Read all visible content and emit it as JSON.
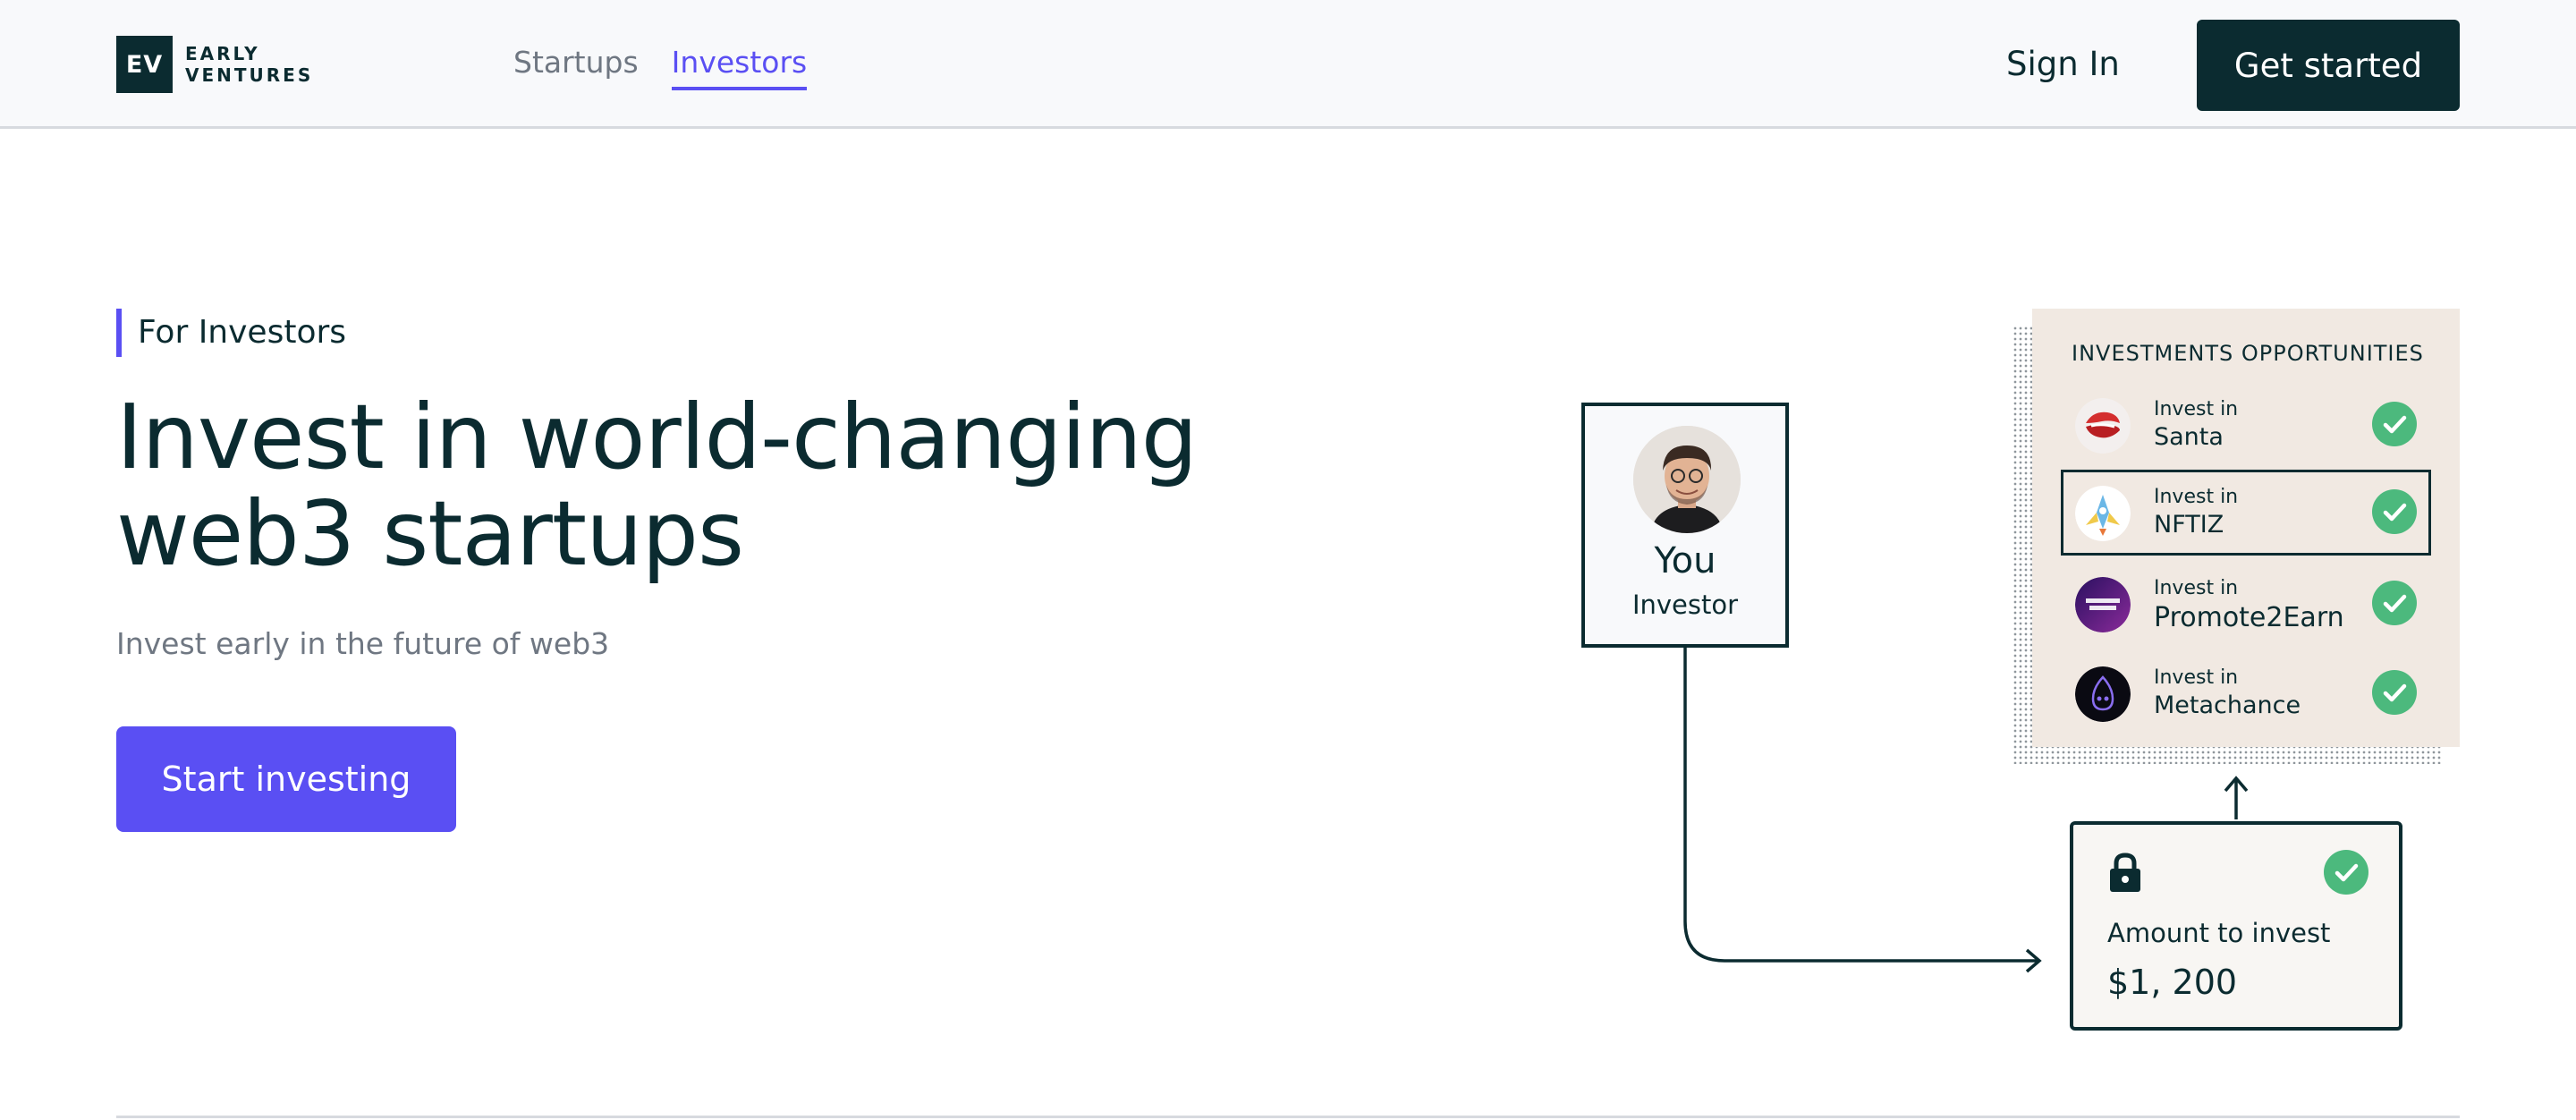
{
  "brand": {
    "mark": "EV",
    "line1": "EARLY",
    "line2": "VENTURES"
  },
  "nav": {
    "items": [
      {
        "label": "Startups"
      },
      {
        "label": "Investors"
      }
    ]
  },
  "header": {
    "signin_label": "Sign In",
    "getstarted_label": "Get started"
  },
  "hero": {
    "tag": "For Investors",
    "headline_line1": "Invest in world-changing",
    "headline_line2": "web3 startups",
    "subtitle": "Invest early in the future of web3",
    "cta_label": "Start investing"
  },
  "investor_card": {
    "name": "You",
    "role": "Investor"
  },
  "opportunities": {
    "title": "INVESTMENTS OPPORTUNITIES",
    "items": [
      {
        "label": "Invest in",
        "name": "Santa",
        "color": "#d42e2e"
      },
      {
        "label": "Invest in",
        "name": "NFTIZ",
        "color": "#6bb7e6"
      },
      {
        "label": "Invest in",
        "name": "Promote2Earn",
        "color": "#5b1f8a"
      },
      {
        "label": "Invest in",
        "name": "Metachance",
        "color": "#0a0a12"
      }
    ]
  },
  "amount": {
    "label": "Amount to invest",
    "value": "$1, 200"
  },
  "colors": {
    "primary": "#0b2b30",
    "accent": "#5a4ff3",
    "success": "#4cb97d",
    "panel": "#f1e9e2"
  }
}
